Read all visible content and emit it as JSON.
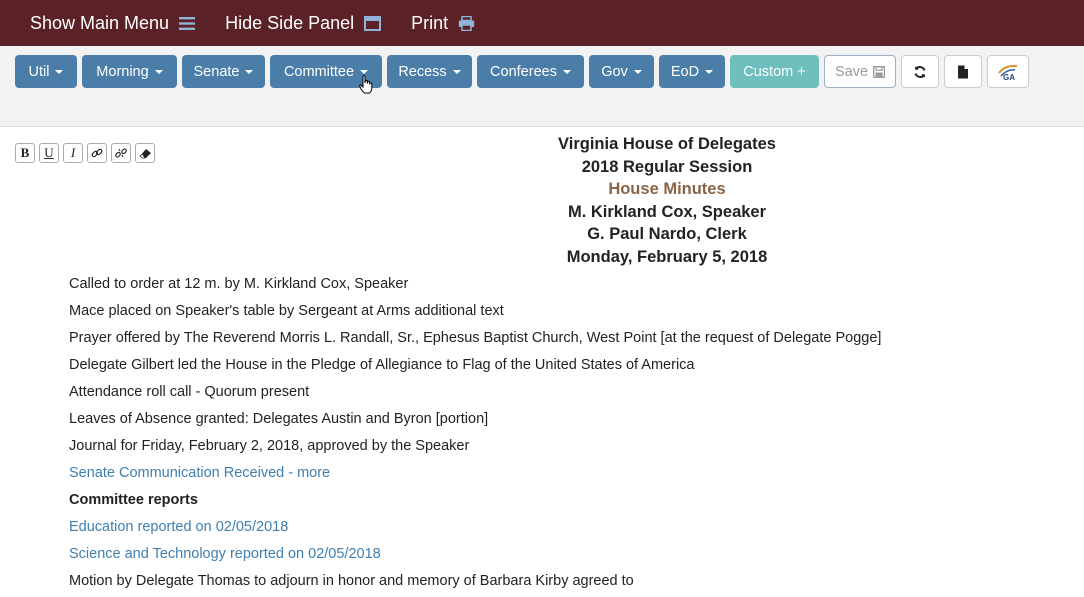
{
  "topbar": {
    "show_main_menu": "Show Main Menu",
    "hide_side_panel": "Hide Side Panel",
    "print": "Print"
  },
  "toolbar": {
    "buttons": [
      "Util",
      "Morning",
      "Senate",
      "Committee",
      "Recess",
      "Conferees",
      "Gov",
      "EoD"
    ],
    "custom": "Custom +",
    "save": "Save",
    "icons": [
      "refresh-icon",
      "document-icon",
      "ga-logo-icon"
    ],
    "format": [
      "B",
      "U",
      "I"
    ]
  },
  "header": {
    "line1": "Virginia House of Delegates",
    "line2": "2018 Regular Session",
    "line3": "House Minutes",
    "line4": "M. Kirkland Cox, Speaker",
    "line5": "G. Paul Nardo, Clerk",
    "line6": "Monday, February 5, 2018"
  },
  "minutes": [
    "Called to order at 12 m. by M. Kirkland Cox, Speaker",
    "Mace placed on Speaker's table by Sergeant at Arms additional text",
    "Prayer offered by The Reverend Morris L. Randall, Sr., Ephesus Baptist Church, West Point [at the request of Delegate Pogge]",
    "Delegate Gilbert led the House in the Pledge of Allegiance to Flag of the United States of America",
    "Attendance roll call - Quorum present",
    "Leaves of Absence granted: Delegates Austin and Byron [portion]",
    "Journal for Friday, February 2, 2018, approved by the Speaker",
    "Senate Communication Received - more",
    "Committee reports",
    "Education reported on 02/05/2018",
    "Science and Technology reported on 02/05/2018",
    "Motion by Delegate Thomas to adjourn in honor and memory of Barbara Kirby agreed to"
  ],
  "colors": {
    "topbar": "#5a2226",
    "button": "#4a7ea8",
    "custom": "#6fbfbf",
    "link": "#3f7fb0",
    "house_minutes": "#8a6446"
  }
}
